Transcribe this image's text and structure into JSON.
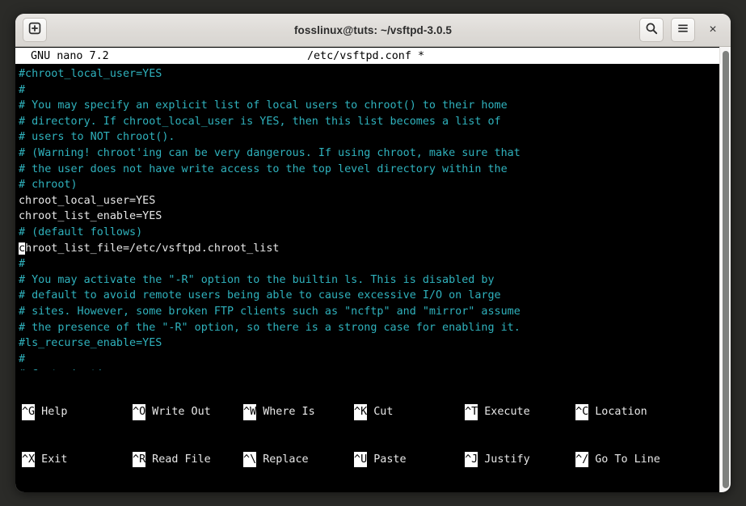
{
  "window": {
    "title": "fosslinux@tuts: ~/vsftpd-3.0.5",
    "new_tab_icon": "new-tab-plus-icon",
    "search_icon": "search-icon",
    "menu_icon": "hamburger-menu-icon",
    "close_label": "×"
  },
  "nano": {
    "version": "GNU nano 7.2",
    "filename": "/etc/vsftpd.conf *",
    "colors": {
      "comment": "#2fb2bd",
      "code": "#e8e8e8",
      "background": "#000000",
      "titlebar_bg": "#ffffff"
    },
    "lines": [
      {
        "text": "#chroot_local_user=YES",
        "type": "comment"
      },
      {
        "text": "#",
        "type": "comment"
      },
      {
        "text": "# You may specify an explicit list of local users to chroot() to their home",
        "type": "comment"
      },
      {
        "text": "# directory. If chroot_local_user is YES, then this list becomes a list of",
        "type": "comment"
      },
      {
        "text": "# users to NOT chroot().",
        "type": "comment"
      },
      {
        "text": "# (Warning! chroot'ing can be very dangerous. If using chroot, make sure that",
        "type": "comment"
      },
      {
        "text": "# the user does not have write access to the top level directory within the",
        "type": "comment"
      },
      {
        "text": "# chroot)",
        "type": "comment"
      },
      {
        "text": "chroot_local_user=YES",
        "type": "code"
      },
      {
        "text": "chroot_list_enable=YES",
        "type": "code"
      },
      {
        "text": "# (default follows)",
        "type": "comment"
      },
      {
        "text": "chroot_list_file=/etc/vsftpd.chroot_list",
        "type": "code",
        "cursor": 0
      },
      {
        "text": "#",
        "type": "comment"
      },
      {
        "text": "# You may activate the \"-R\" option to the builtin ls. This is disabled by",
        "type": "comment"
      },
      {
        "text": "# default to avoid remote users being able to cause excessive I/O on large",
        "type": "comment"
      },
      {
        "text": "# sites. However, some broken FTP clients such as \"ncftp\" and \"mirror\" assume",
        "type": "comment"
      },
      {
        "text": "# the presence of the \"-R\" option, so there is a strong case for enabling it.",
        "type": "comment"
      },
      {
        "text": "#ls_recurse_enable=YES",
        "type": "comment"
      },
      {
        "text": "#",
        "type": "comment"
      },
      {
        "text": "# Customization",
        "type": "comment"
      },
      {
        "text": "#",
        "type": "comment"
      }
    ],
    "shortcuts_row1": [
      {
        "key": "^G",
        "label": "Help"
      },
      {
        "key": "^O",
        "label": "Write Out"
      },
      {
        "key": "^W",
        "label": "Where Is"
      },
      {
        "key": "^K",
        "label": "Cut"
      },
      {
        "key": "^T",
        "label": "Execute"
      },
      {
        "key": "^C",
        "label": "Location"
      }
    ],
    "shortcuts_row2": [
      {
        "key": "^X",
        "label": "Exit"
      },
      {
        "key": "^R",
        "label": "Read File"
      },
      {
        "key": "^\\",
        "label": "Replace"
      },
      {
        "key": "^U",
        "label": "Paste"
      },
      {
        "key": "^J",
        "label": "Justify"
      },
      {
        "key": "^/",
        "label": "Go To Line"
      }
    ]
  }
}
